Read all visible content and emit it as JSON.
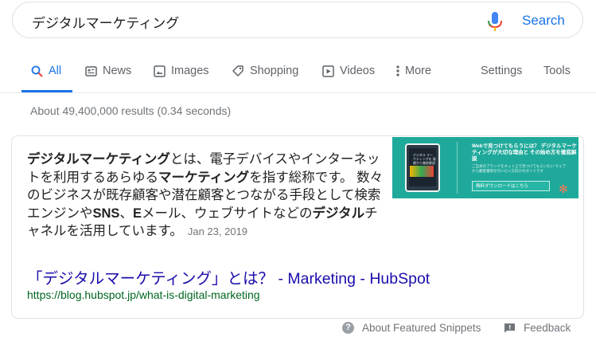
{
  "search": {
    "query": "デジタルマーケティング",
    "button_label": "Search"
  },
  "tabs": [
    {
      "label": "All",
      "icon": "search-icon",
      "active": true
    },
    {
      "label": "News",
      "icon": "news-icon"
    },
    {
      "label": "Images",
      "icon": "image-icon"
    },
    {
      "label": "Shopping",
      "icon": "tag-icon"
    },
    {
      "label": "Videos",
      "icon": "play-icon"
    },
    {
      "label": "More",
      "icon": "more-vert-icon"
    }
  ],
  "tools": {
    "settings": "Settings",
    "tools": "Tools"
  },
  "stats": "About 49,400,000 results (0.34 seconds)",
  "featured": {
    "snippet_parts": [
      {
        "text": "デジタルマーケティング",
        "bold": true
      },
      {
        "text": "とは、電子デバイスやインターネットを利用するあらゆる",
        "bold": false
      },
      {
        "text": "マーケティング",
        "bold": true
      },
      {
        "text": "を指す総称です。 数々のビジネスが既存顧客や潜在顧客とつながる手段として検索エンジンや",
        "bold": false
      },
      {
        "text": "SNS",
        "bold": true
      },
      {
        "text": "、",
        "bold": false
      },
      {
        "text": "E",
        "bold": true
      },
      {
        "text": "メール、ウェブサイトなどの",
        "bold": false
      },
      {
        "text": "デジタル",
        "bold": true
      },
      {
        "text": "チャネルを活用しています。",
        "bold": false
      }
    ],
    "date": "Jan 23, 2019",
    "image": {
      "phone_text": "デジタル マーケティングを 基礎から徹底解説",
      "headline": "Webで見つけてもらうには？ デジタルマーケティングが大切な理由と その始め方を徹底解説",
      "body": "ご自身のブランドをネット上で見つけてもらいたい ウェブから顧客獲得を行いたい方向けのガイドです",
      "button": "無料ダウンロードはこちら",
      "logo": "HubSpot"
    },
    "title": "「デジタルマーケティング」とは？ - Marketing - HubSpot",
    "url": "https://blog.hubspot.jp/what-is-digital-marketing"
  },
  "footer": {
    "about": "About Featured Snippets",
    "feedback": "Feedback"
  },
  "colors": {
    "link": "#1a0dab",
    "accent": "#1a73e8",
    "url": "#006621",
    "muted": "#70757a"
  }
}
